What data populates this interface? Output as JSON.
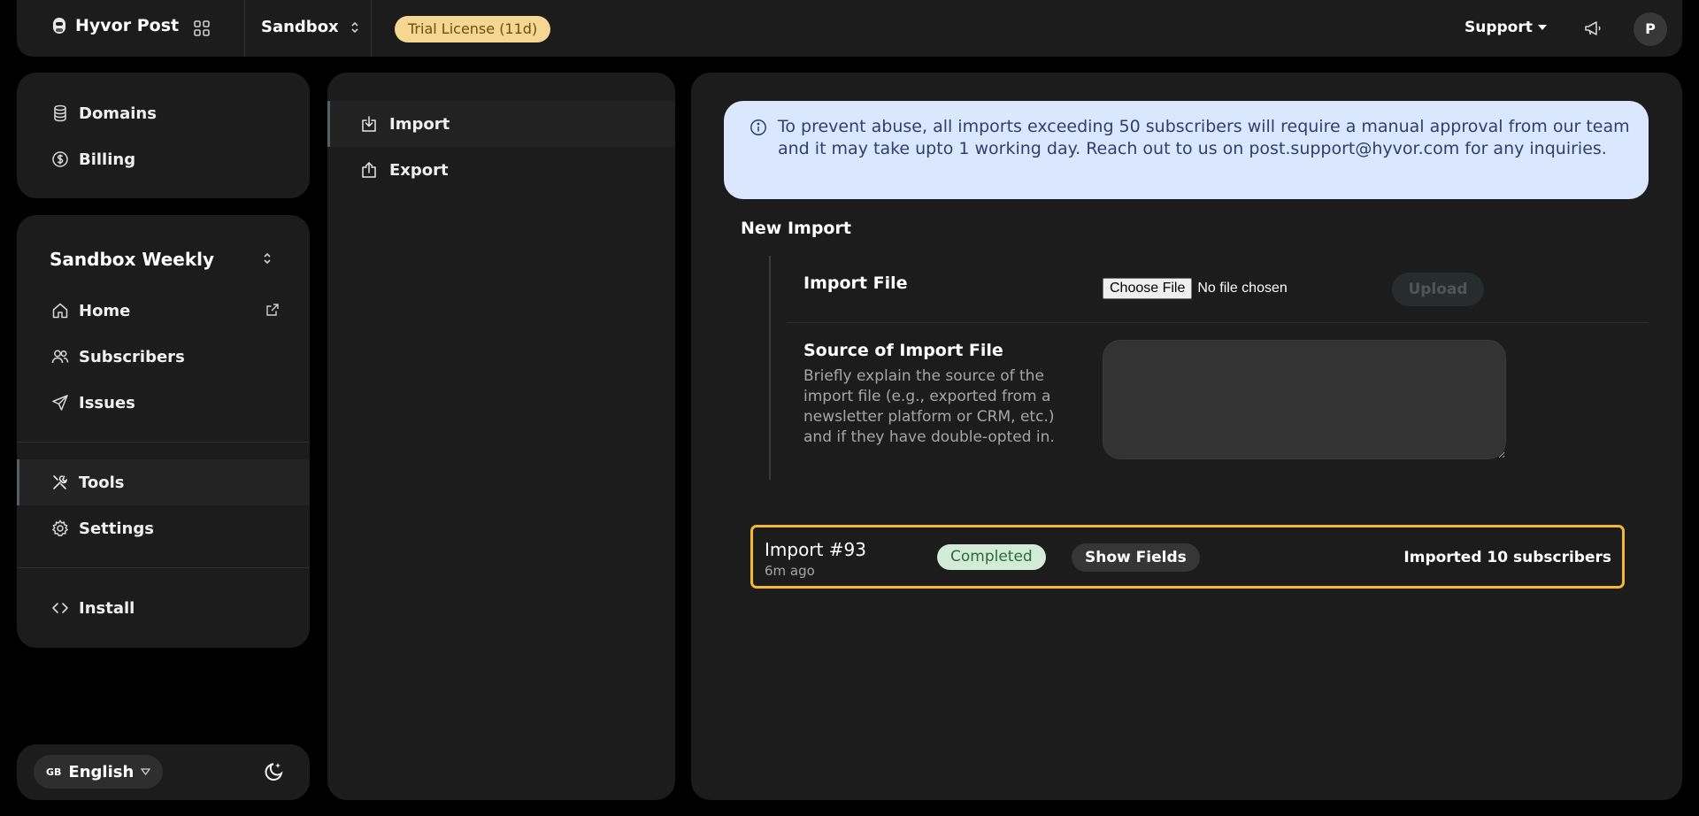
{
  "topbar": {
    "app_name": "Hyvor Post",
    "project": "Sandbox",
    "trial_badge": "Trial License (11d)",
    "support_label": "Support",
    "avatar_initial": "P"
  },
  "sidebar": {
    "account_items": [
      {
        "label": "Domains",
        "icon": "database-icon"
      },
      {
        "label": "Billing",
        "icon": "dollar-circle-icon"
      }
    ],
    "newsletter_name": "Sandbox Weekly",
    "nav_items": [
      {
        "label": "Home",
        "icon": "home-icon"
      },
      {
        "label": "Subscribers",
        "icon": "users-icon"
      },
      {
        "label": "Issues",
        "icon": "send-icon"
      },
      {
        "label": "Tools",
        "icon": "tools-icon",
        "active": true
      },
      {
        "label": "Settings",
        "icon": "gear-icon"
      },
      {
        "label": "Install",
        "icon": "code-icon"
      }
    ],
    "language": {
      "flag": "GB",
      "label": "English"
    }
  },
  "tools_menu": {
    "items": [
      {
        "label": "Import",
        "icon": "import-icon",
        "active": true
      },
      {
        "label": "Export",
        "icon": "export-icon"
      }
    ]
  },
  "main": {
    "notice": "To prevent abuse, all imports exceeding 50 subscribers will require a manual approval from our team and it may take upto 1 working day. Reach out to us on post.support@hyvor.com for any inquiries.",
    "new_import_title": "New Import",
    "import_file_label": "Import File",
    "choose_file_label": "Choose File",
    "no_file_text": "No file chosen",
    "upload_label": "Upload",
    "source_label": "Source of Import File",
    "source_description": "Briefly explain the source of the import file (e.g., exported from a newsletter platform or CRM, etc.) and if they have double-opted in.",
    "source_value": "",
    "imports": [
      {
        "title": "Import #93",
        "time": "6m ago",
        "status": "Completed",
        "show_fields_label": "Show Fields",
        "result": "Imported 10 subscribers"
      }
    ]
  },
  "colors": {
    "background": "#000000",
    "panel": "#1c1c1c",
    "notice_bg": "#dbe6ff",
    "trial_badge_bg": "#f5d791",
    "completed_badge_bg": "#d4ecd7",
    "highlight_border": "#f5b82e"
  }
}
